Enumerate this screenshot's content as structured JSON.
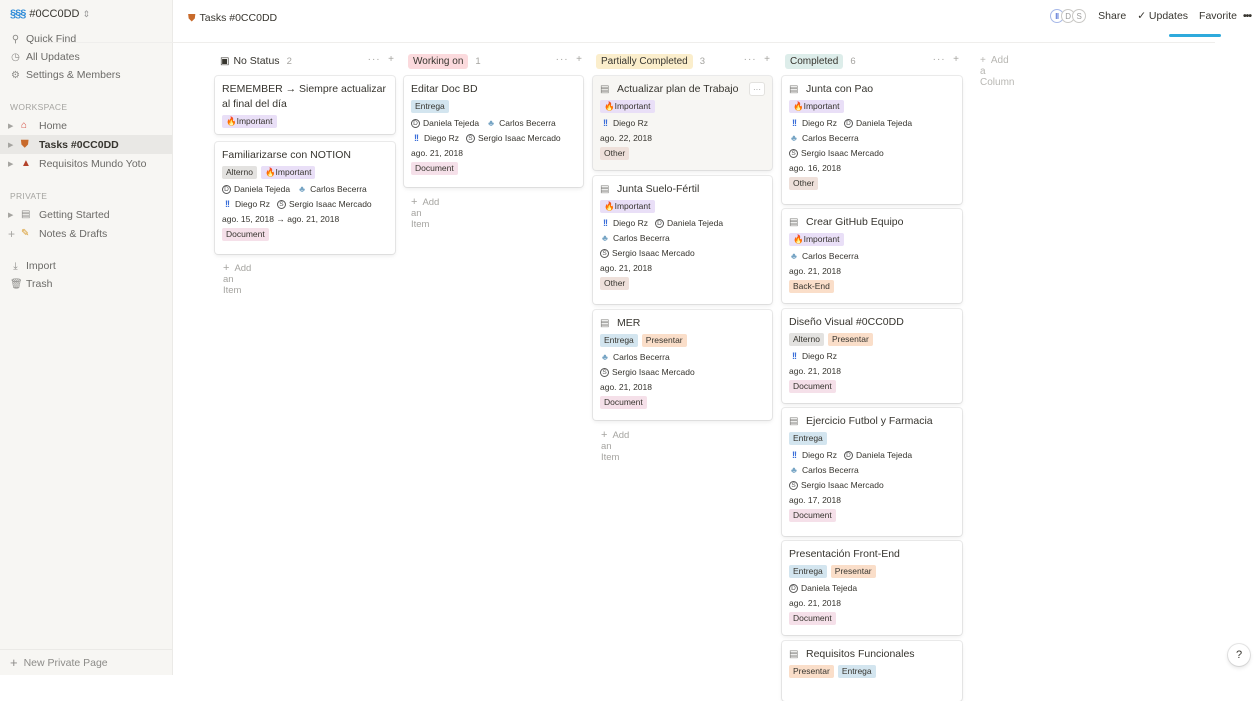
{
  "sidebar": {
    "workspace_name": "#0CC0DD",
    "workspace_logo": "§§§",
    "nav": [
      {
        "label": "Quick Find",
        "icon": "search-icon"
      },
      {
        "label": "All Updates",
        "icon": "clock-icon"
      },
      {
        "label": "Settings & Members",
        "icon": "gear-icon"
      }
    ],
    "section_workspace": "WORKSPACE",
    "section_private": "PRIVATE",
    "workspace_pages": [
      {
        "label": "Home",
        "icon": "home-icon"
      },
      {
        "label": "Tasks #0CC0DD",
        "icon": "shield-icon"
      },
      {
        "label": "Requisitos Mundo Yoto",
        "icon": "mountain-icon"
      }
    ],
    "private_pages": [
      {
        "label": "Getting Started",
        "icon": "document-icon"
      },
      {
        "label": "Notes & Drafts",
        "icon": "drafts-icon"
      }
    ],
    "import_label": "Import",
    "trash_label": "Trash",
    "new_page_label": "New Private Page"
  },
  "topbar": {
    "breadcrumb": "Tasks #0CC0DD",
    "share": "Share",
    "updates": "Updates",
    "favorite": "Favorite",
    "more": "•••",
    "avatars": [
      "‖",
      "D",
      "S"
    ]
  },
  "board": {
    "add_item": "Add an Item",
    "add_column": "Add a Column",
    "columns": [
      {
        "title": "No Status",
        "count": "2"
      },
      {
        "title": "Working on",
        "count": "1"
      },
      {
        "title": "Partially Completed",
        "count": "3"
      },
      {
        "title": "Completed",
        "count": "6"
      }
    ],
    "cards": {
      "c1": {
        "title": "REMEMBER → Siempre actualizar al final del día",
        "tags": [
          "Important"
        ]
      },
      "c2": {
        "title": "Familiarizarse con NOTION",
        "tags": [
          "Alterno",
          "Important"
        ],
        "people1": "Daniela Tejeda",
        "people2": "Carlos Becerra",
        "people3": "Diego Rz",
        "people4": "Sergio Isaac Mercado",
        "date": "ago. 15, 2018 → ago. 21, 2018",
        "type": "Document"
      },
      "c3": {
        "title": "Editar Doc BD",
        "tags": [
          "Entrega"
        ],
        "people1": "Daniela Tejeda",
        "people2": "Carlos Becerra",
        "people3": "Diego Rz",
        "people4": "Sergio Isaac Mercado",
        "date": "ago. 21, 2018",
        "type": "Document"
      },
      "c4": {
        "title": "Actualizar plan de Trabajo",
        "tags": [
          "Important"
        ],
        "people1": "Diego Rz",
        "date": "ago. 22, 2018",
        "type": "Other"
      },
      "c5": {
        "title": "Junta Suelo-Fértil",
        "tags": [
          "Important"
        ],
        "people1": "Diego Rz",
        "people2": "Daniela Tejeda",
        "people3": "Carlos Becerra",
        "people4": "Sergio Isaac Mercado",
        "date": "ago. 21, 2018",
        "type": "Other"
      },
      "c6": {
        "title": "MER",
        "tags": [
          "Entrega",
          "Presentar"
        ],
        "people1": "Carlos Becerra",
        "people2": "Sergio Isaac Mercado",
        "date": "ago. 21, 2018",
        "type": "Document"
      },
      "c7": {
        "title": "Junta con Pao",
        "tags": [
          "Important"
        ],
        "people1": "Diego Rz",
        "people2": "Daniela Tejeda",
        "people3": "Carlos Becerra",
        "people4": "Sergio Isaac Mercado",
        "date": "ago. 16, 2018",
        "type": "Other"
      },
      "c8": {
        "title": "Crear GitHub Equipo",
        "tags": [
          "Important"
        ],
        "people1": "Carlos Becerra",
        "date": "ago. 21, 2018",
        "type": "Back-End"
      },
      "c9": {
        "title": "Diseño Visual #0CC0DD",
        "tags": [
          "Alterno",
          "Presentar"
        ],
        "people1": "Diego Rz",
        "date": "ago. 21, 2018",
        "type": "Document"
      },
      "c10": {
        "title": "Ejercicio Futbol y Farmacia",
        "tags": [
          "Entrega"
        ],
        "people1": "Diego Rz",
        "people2": "Daniela Tejeda",
        "people3": "Carlos Becerra",
        "people4": "Sergio Isaac Mercado",
        "date": "ago. 17, 2018",
        "type": "Document"
      },
      "c11": {
        "title": "Presentación Front-End",
        "tags": [
          "Entrega",
          "Presentar"
        ],
        "people1": "Daniela Tejeda",
        "date": "ago. 21, 2018",
        "type": "Document"
      },
      "c12": {
        "title": "Requisitos Funcionales",
        "tags": [
          "Presentar",
          "Entrega"
        ]
      }
    }
  },
  "help": "?",
  "colors": {
    "no_status": "#ffffff",
    "working_on": "#fbdadd",
    "partially": "#fbeecc",
    "completed": "#ddedea",
    "important": "#e9dff7",
    "entrega": "#d3e5ef",
    "presentar": "#fadec9",
    "alterno": "#e3e2e0",
    "document": "#f5e0e9",
    "other": "#eee0da",
    "backend": "#fadec9"
  }
}
